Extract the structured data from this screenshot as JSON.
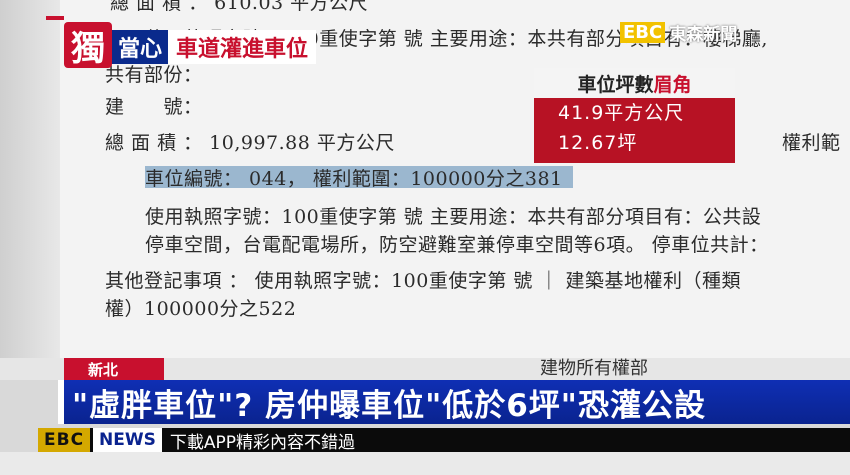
{
  "document": {
    "line_1": "總 面 積 ： 610.03 平方公尺",
    "line_2": "使用執照字號：100重使字第 號 主要用途：本共有部分項目有：樓梯廳,",
    "line_3": "共有部份：",
    "line_4": "建　　號：",
    "line_5": "總 面 積 ： 10,997.88 平方公尺",
    "line_5_right": "權利範",
    "line_6": "車位編號： 044， 權利範圍：100000分之381",
    "line_7": "使用執照字號：100重使字第 號 主要用途：本共有部分項目有：公共設",
    "line_8": "停車空間，台電配電場所，防空避難室兼停車空間等6項。 停車位共計：",
    "line_9": "其他登記事項 ： 使用執照字號：100重使字第 號 ｜ 建築基地權利（種類",
    "line_10": "權）100000分之522"
  },
  "badge": {
    "char": "獨"
  },
  "title": {
    "part_a": "當心",
    "part_b": "車道灌進車位"
  },
  "channel_logo": {
    "ebc": "EBC",
    "name": "東森新聞"
  },
  "info_box": {
    "heading_black": "車位坪數",
    "heading_red": "眉角",
    "value_1": "41.9平方公尺",
    "value_2": "12.67坪"
  },
  "location": {
    "tag": "新北",
    "doc_caption": "建物所有權部"
  },
  "headline": "\"虛胖車位\"? 房仲曝車位\"低於6坪\"恐灌公設",
  "ticker": {
    "ebc": "EBC",
    "news": "NEWS",
    "text": "下載APP精彩內容不錯過"
  },
  "colors": {
    "brand_red": "#c8102e",
    "headline_blue": "#0a238f",
    "highlight": "#9bb7cf"
  }
}
